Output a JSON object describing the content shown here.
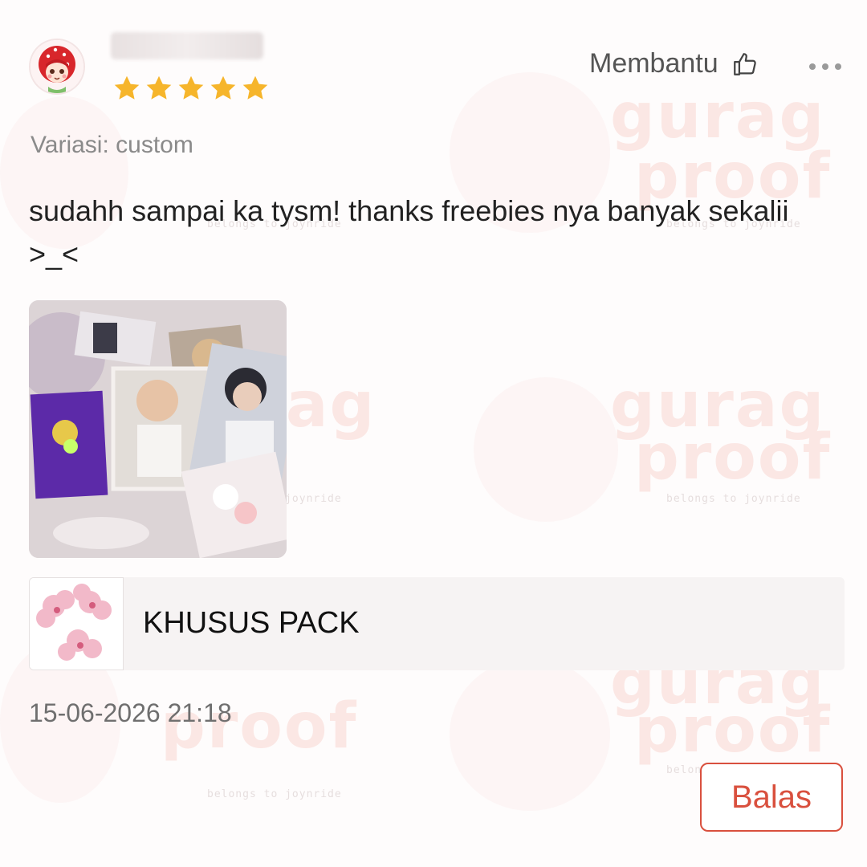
{
  "review": {
    "rating": 5,
    "helpful_label": "Membantu",
    "variation": "Variasi: custom",
    "text": "sudahh sampai ka tysm! thanks freebies nya banyak sekalii >_<",
    "product_name": "KHUSUS PACK",
    "timestamp": "15-06-2026 21:18",
    "reply_label": "Balas"
  },
  "watermark": {
    "word_1": "gurag",
    "word_2": "proof",
    "tag": "belongs to joynride"
  },
  "icons": {
    "rating": "star-icon",
    "helpful": "thumbs-up-icon",
    "more": "more-dots-icon"
  },
  "colors": {
    "star": "#f6b52b",
    "reply_accent": "#d9503e"
  }
}
